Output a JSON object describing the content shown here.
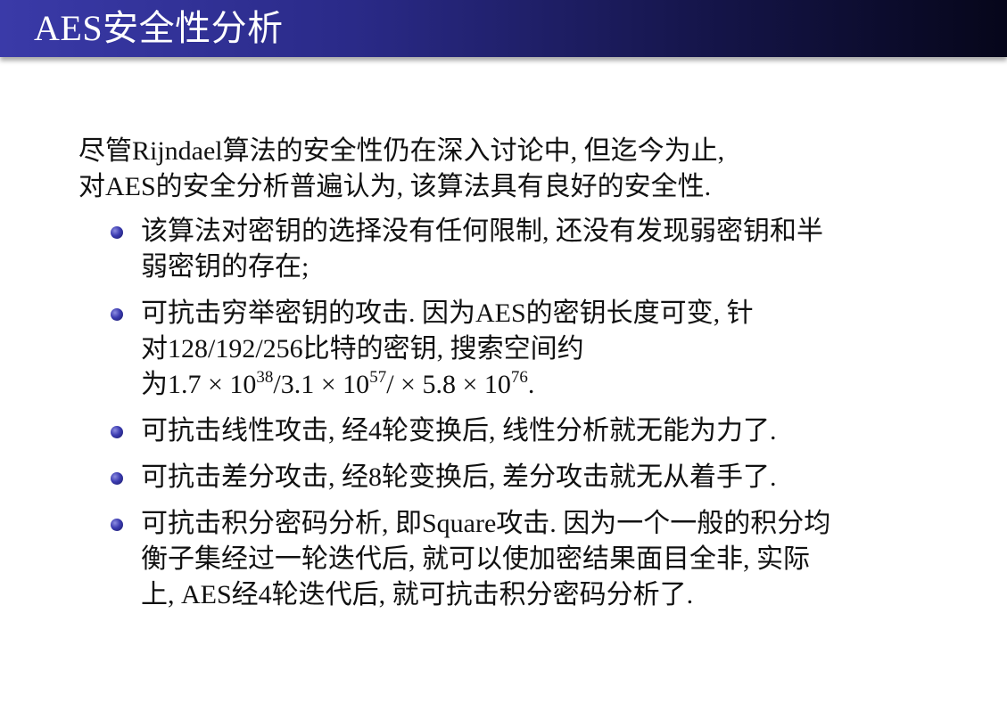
{
  "title": "AES安全性分析",
  "intro": [
    "尽管Rijndael算法的安全性仍在深入讨论中, 但迄今为止,",
    "对AES的安全分析普遍认为, 该算法具有良好的安全性."
  ],
  "bullets": [
    {
      "lines": [
        "该算法对密钥的选择没有任何限制, 还没有发现弱密钥和半",
        "弱密钥的存在;"
      ]
    },
    {
      "lines": [
        "可抗击穷举密钥的攻击. 因为AES的密钥长度可变, 针",
        "对128/192/256比特的密钥, 搜索空间约"
      ],
      "formula": {
        "prefix": "为",
        "a": "1.7 × 10",
        "a_exp": "38",
        "b": "/3.1 × 10",
        "b_exp": "57",
        "c": "/ × 5.8 × 10",
        "c_exp": "76",
        "end": "."
      }
    },
    {
      "lines": [
        "可抗击线性攻击, 经4轮变换后, 线性分析就无能为力了."
      ]
    },
    {
      "lines": [
        "可抗击差分攻击, 经8轮变换后, 差分攻击就无从着手了."
      ]
    },
    {
      "lines": [
        "可抗击积分密码分析, 即Square攻击. 因为一个一般的积分均",
        "衡子集经过一轮迭代后, 就可以使加密结果面目全非, 实际",
        "上, AES经4轮迭代后, 就可抗击积分密码分析了."
      ]
    }
  ]
}
